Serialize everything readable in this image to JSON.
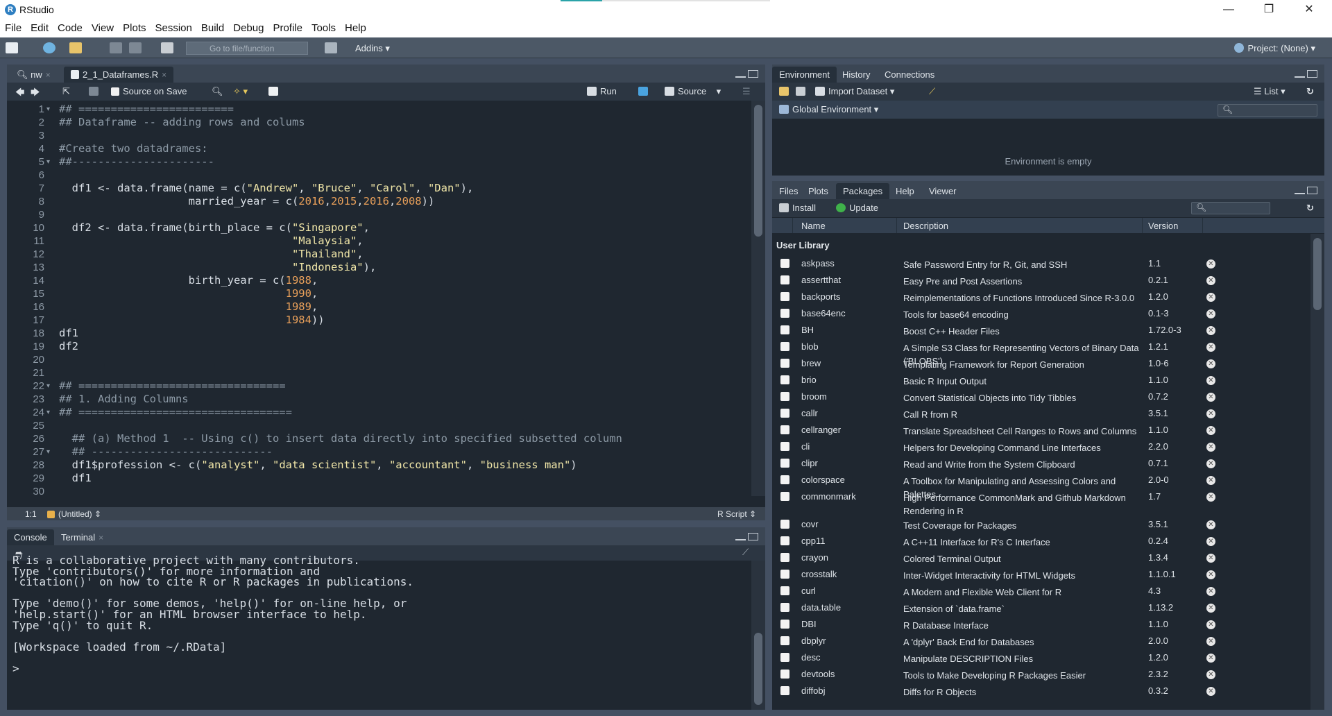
{
  "window": {
    "title": "RStudio",
    "min": "—",
    "max": "❐",
    "close": "✕"
  },
  "menu": [
    "File",
    "Edit",
    "Code",
    "View",
    "Plots",
    "Session",
    "Build",
    "Debug",
    "Profile",
    "Tools",
    "Help"
  ],
  "toolbar": {
    "goto_placeholder": "Go to file/function",
    "addins": "Addins",
    "project": "Project: (None)"
  },
  "editor": {
    "tabs": [
      {
        "label": "nw"
      },
      {
        "label": "2_1_Dataframes.R"
      }
    ],
    "source_on_save": "Source on Save",
    "run": "Run",
    "source": "Source",
    "status_position": "1:1",
    "status_scope": "(Untitled)",
    "status_type": "R Script"
  },
  "code_lines": [
    {
      "n": "1",
      "fold": true,
      "segs": [
        [
          "cm",
          "## ========================"
        ]
      ]
    },
    {
      "n": "2",
      "segs": [
        [
          "cm",
          "## Dataframe -- adding rows and colums"
        ]
      ]
    },
    {
      "n": "3",
      "segs": []
    },
    {
      "n": "4",
      "segs": [
        [
          "cm",
          "#Create two datadrames:"
        ]
      ]
    },
    {
      "n": "5",
      "fold": true,
      "segs": [
        [
          "cm",
          "##----------------------"
        ]
      ]
    },
    {
      "n": "6",
      "segs": []
    },
    {
      "n": "7",
      "segs": [
        [
          "op",
          "  df1 <- data.frame(name = c("
        ],
        [
          "st",
          "\"Andrew\""
        ],
        [
          "op",
          ", "
        ],
        [
          "st",
          "\"Bruce\""
        ],
        [
          "op",
          ", "
        ],
        [
          "st",
          "\"Carol\""
        ],
        [
          "op",
          ", "
        ],
        [
          "st",
          "\"Dan\""
        ],
        [
          "op",
          "),"
        ]
      ]
    },
    {
      "n": "8",
      "segs": [
        [
          "op",
          "                    married_year = c("
        ],
        [
          "nu",
          "2016"
        ],
        [
          "op",
          ","
        ],
        [
          "nu",
          "2015"
        ],
        [
          "op",
          ","
        ],
        [
          "nu",
          "2016"
        ],
        [
          "op",
          ","
        ],
        [
          "nu",
          "2008"
        ],
        [
          "op",
          "))"
        ]
      ]
    },
    {
      "n": "9",
      "segs": []
    },
    {
      "n": "10",
      "segs": [
        [
          "op",
          "  df2 <- data.frame(birth_place = c("
        ],
        [
          "st",
          "\"Singapore\""
        ],
        [
          "op",
          ","
        ]
      ]
    },
    {
      "n": "11",
      "segs": [
        [
          "op",
          "                                    "
        ],
        [
          "st",
          "\"Malaysia\""
        ],
        [
          "op",
          ","
        ]
      ]
    },
    {
      "n": "12",
      "segs": [
        [
          "op",
          "                                    "
        ],
        [
          "st",
          "\"Thailand\""
        ],
        [
          "op",
          ","
        ]
      ]
    },
    {
      "n": "13",
      "segs": [
        [
          "op",
          "                                    "
        ],
        [
          "st",
          "\"Indonesia\""
        ],
        [
          "op",
          "),"
        ]
      ]
    },
    {
      "n": "14",
      "segs": [
        [
          "op",
          "                    birth_year = c("
        ],
        [
          "nu",
          "1988"
        ],
        [
          "op",
          ","
        ]
      ]
    },
    {
      "n": "15",
      "segs": [
        [
          "op",
          "                                   "
        ],
        [
          "nu",
          "1990"
        ],
        [
          "op",
          ","
        ]
      ]
    },
    {
      "n": "16",
      "segs": [
        [
          "op",
          "                                   "
        ],
        [
          "nu",
          "1989"
        ],
        [
          "op",
          ","
        ]
      ]
    },
    {
      "n": "17",
      "segs": [
        [
          "op",
          "                                   "
        ],
        [
          "nu",
          "1984"
        ],
        [
          "op",
          "))"
        ]
      ]
    },
    {
      "n": "18",
      "segs": [
        [
          "op",
          "df1"
        ]
      ]
    },
    {
      "n": "19",
      "segs": [
        [
          "op",
          "df2"
        ]
      ]
    },
    {
      "n": "20",
      "segs": []
    },
    {
      "n": "21",
      "segs": []
    },
    {
      "n": "22",
      "fold": true,
      "segs": [
        [
          "cm",
          "## ================================"
        ]
      ]
    },
    {
      "n": "23",
      "segs": [
        [
          "cm",
          "## 1. Adding Columns"
        ]
      ]
    },
    {
      "n": "24",
      "fold": true,
      "segs": [
        [
          "cm",
          "## ================================="
        ]
      ]
    },
    {
      "n": "25",
      "segs": []
    },
    {
      "n": "26",
      "segs": [
        [
          "cm",
          "  ## (a) Method 1  -- Using c() to insert data directly into specified subsetted column"
        ]
      ]
    },
    {
      "n": "27",
      "fold": true,
      "segs": [
        [
          "cm",
          "  ## ----------------------------"
        ]
      ]
    },
    {
      "n": "28",
      "segs": [
        [
          "op",
          "  df1$profession <- c("
        ],
        [
          "st",
          "\"analyst\""
        ],
        [
          "op",
          ", "
        ],
        [
          "st",
          "\"data scientist\""
        ],
        [
          "op",
          ", "
        ],
        [
          "st",
          "\"accountant\""
        ],
        [
          "op",
          ", "
        ],
        [
          "st",
          "\"business man\""
        ],
        [
          "op",
          ")"
        ]
      ]
    },
    {
      "n": "29",
      "segs": [
        [
          "op",
          "  df1"
        ]
      ]
    },
    {
      "n": "30",
      "segs": []
    }
  ],
  "console": {
    "tabs": [
      {
        "label": "Console"
      },
      {
        "label": "Terminal"
      }
    ],
    "path": "~/",
    "lines": [
      "R is a collaborative project with many contributors.",
      "Type 'contributors()' for more information and",
      "'citation()' on how to cite R or R packages in publications.",
      "",
      "Type 'demo()' for some demos, 'help()' for on-line help, or",
      "'help.start()' for an HTML browser interface to help.",
      "Type 'q()' to quit R.",
      "",
      "[Workspace loaded from ~/.RData]",
      "",
      ">"
    ]
  },
  "environment": {
    "tabs": [
      {
        "label": "Environment"
      },
      {
        "label": "History"
      },
      {
        "label": "Connections"
      }
    ],
    "import_dataset": "Import Dataset",
    "list": "List",
    "scope": "Global Environment",
    "empty": "Environment is empty"
  },
  "files": {
    "tabs": [
      {
        "label": "Files"
      },
      {
        "label": "Plots"
      },
      {
        "label": "Packages"
      },
      {
        "label": "Help"
      },
      {
        "label": "Viewer"
      }
    ],
    "install": "Install",
    "update": "Update",
    "columns": [
      "Name",
      "Description",
      "Version"
    ],
    "section": "User Library",
    "packages": [
      {
        "name": "askpass",
        "desc": "Safe Password Entry for R, Git, and SSH",
        "ver": "1.1"
      },
      {
        "name": "assertthat",
        "desc": "Easy Pre and Post Assertions",
        "ver": "0.2.1"
      },
      {
        "name": "backports",
        "desc": "Reimplementations of Functions Introduced Since R-3.0.0",
        "ver": "1.2.0"
      },
      {
        "name": "base64enc",
        "desc": "Tools for base64 encoding",
        "ver": "0.1-3"
      },
      {
        "name": "BH",
        "desc": "Boost C++ Header Files",
        "ver": "1.72.0-3"
      },
      {
        "name": "blob",
        "desc": "A Simple S3 Class for Representing Vectors of Binary Data ('BLOBS')",
        "ver": "1.2.1"
      },
      {
        "name": "brew",
        "desc": "Templating Framework for Report Generation",
        "ver": "1.0-6"
      },
      {
        "name": "brio",
        "desc": "Basic R Input Output",
        "ver": "1.1.0"
      },
      {
        "name": "broom",
        "desc": "Convert Statistical Objects into Tidy Tibbles",
        "ver": "0.7.2"
      },
      {
        "name": "callr",
        "desc": "Call R from R",
        "ver": "3.5.1"
      },
      {
        "name": "cellranger",
        "desc": "Translate Spreadsheet Cell Ranges to Rows and Columns",
        "ver": "1.1.0"
      },
      {
        "name": "cli",
        "desc": "Helpers for Developing Command Line Interfaces",
        "ver": "2.2.0"
      },
      {
        "name": "clipr",
        "desc": "Read and Write from the System Clipboard",
        "ver": "0.7.1"
      },
      {
        "name": "colorspace",
        "desc": "A Toolbox for Manipulating and Assessing Colors and Palettes",
        "ver": "2.0-0"
      },
      {
        "name": "commonmark",
        "desc": "High Performance CommonMark and Github Markdown Rendering in R",
        "ver": "1.7",
        "tall": true
      },
      {
        "name": "covr",
        "desc": "Test Coverage for Packages",
        "ver": "3.5.1"
      },
      {
        "name": "cpp11",
        "desc": "A C++11 Interface for R's C Interface",
        "ver": "0.2.4"
      },
      {
        "name": "crayon",
        "desc": "Colored Terminal Output",
        "ver": "1.3.4"
      },
      {
        "name": "crosstalk",
        "desc": "Inter-Widget Interactivity for HTML Widgets",
        "ver": "1.1.0.1"
      },
      {
        "name": "curl",
        "desc": "A Modern and Flexible Web Client for R",
        "ver": "4.3"
      },
      {
        "name": "data.table",
        "desc": "Extension of `data.frame`",
        "ver": "1.13.2"
      },
      {
        "name": "DBI",
        "desc": "R Database Interface",
        "ver": "1.1.0"
      },
      {
        "name": "dbplyr",
        "desc": "A 'dplyr' Back End for Databases",
        "ver": "2.0.0"
      },
      {
        "name": "desc",
        "desc": "Manipulate DESCRIPTION Files",
        "ver": "1.2.0"
      },
      {
        "name": "devtools",
        "desc": "Tools to Make Developing R Packages Easier",
        "ver": "2.3.2"
      },
      {
        "name": "diffobj",
        "desc": "Diffs for R Objects",
        "ver": "0.3.2"
      }
    ]
  },
  "colors": {
    "string": "#f0e6a8",
    "number": "#e9a05a",
    "comment": "#8d9aa6",
    "pane_bg": "#1f2730",
    "toolbar": "#4c5866"
  }
}
